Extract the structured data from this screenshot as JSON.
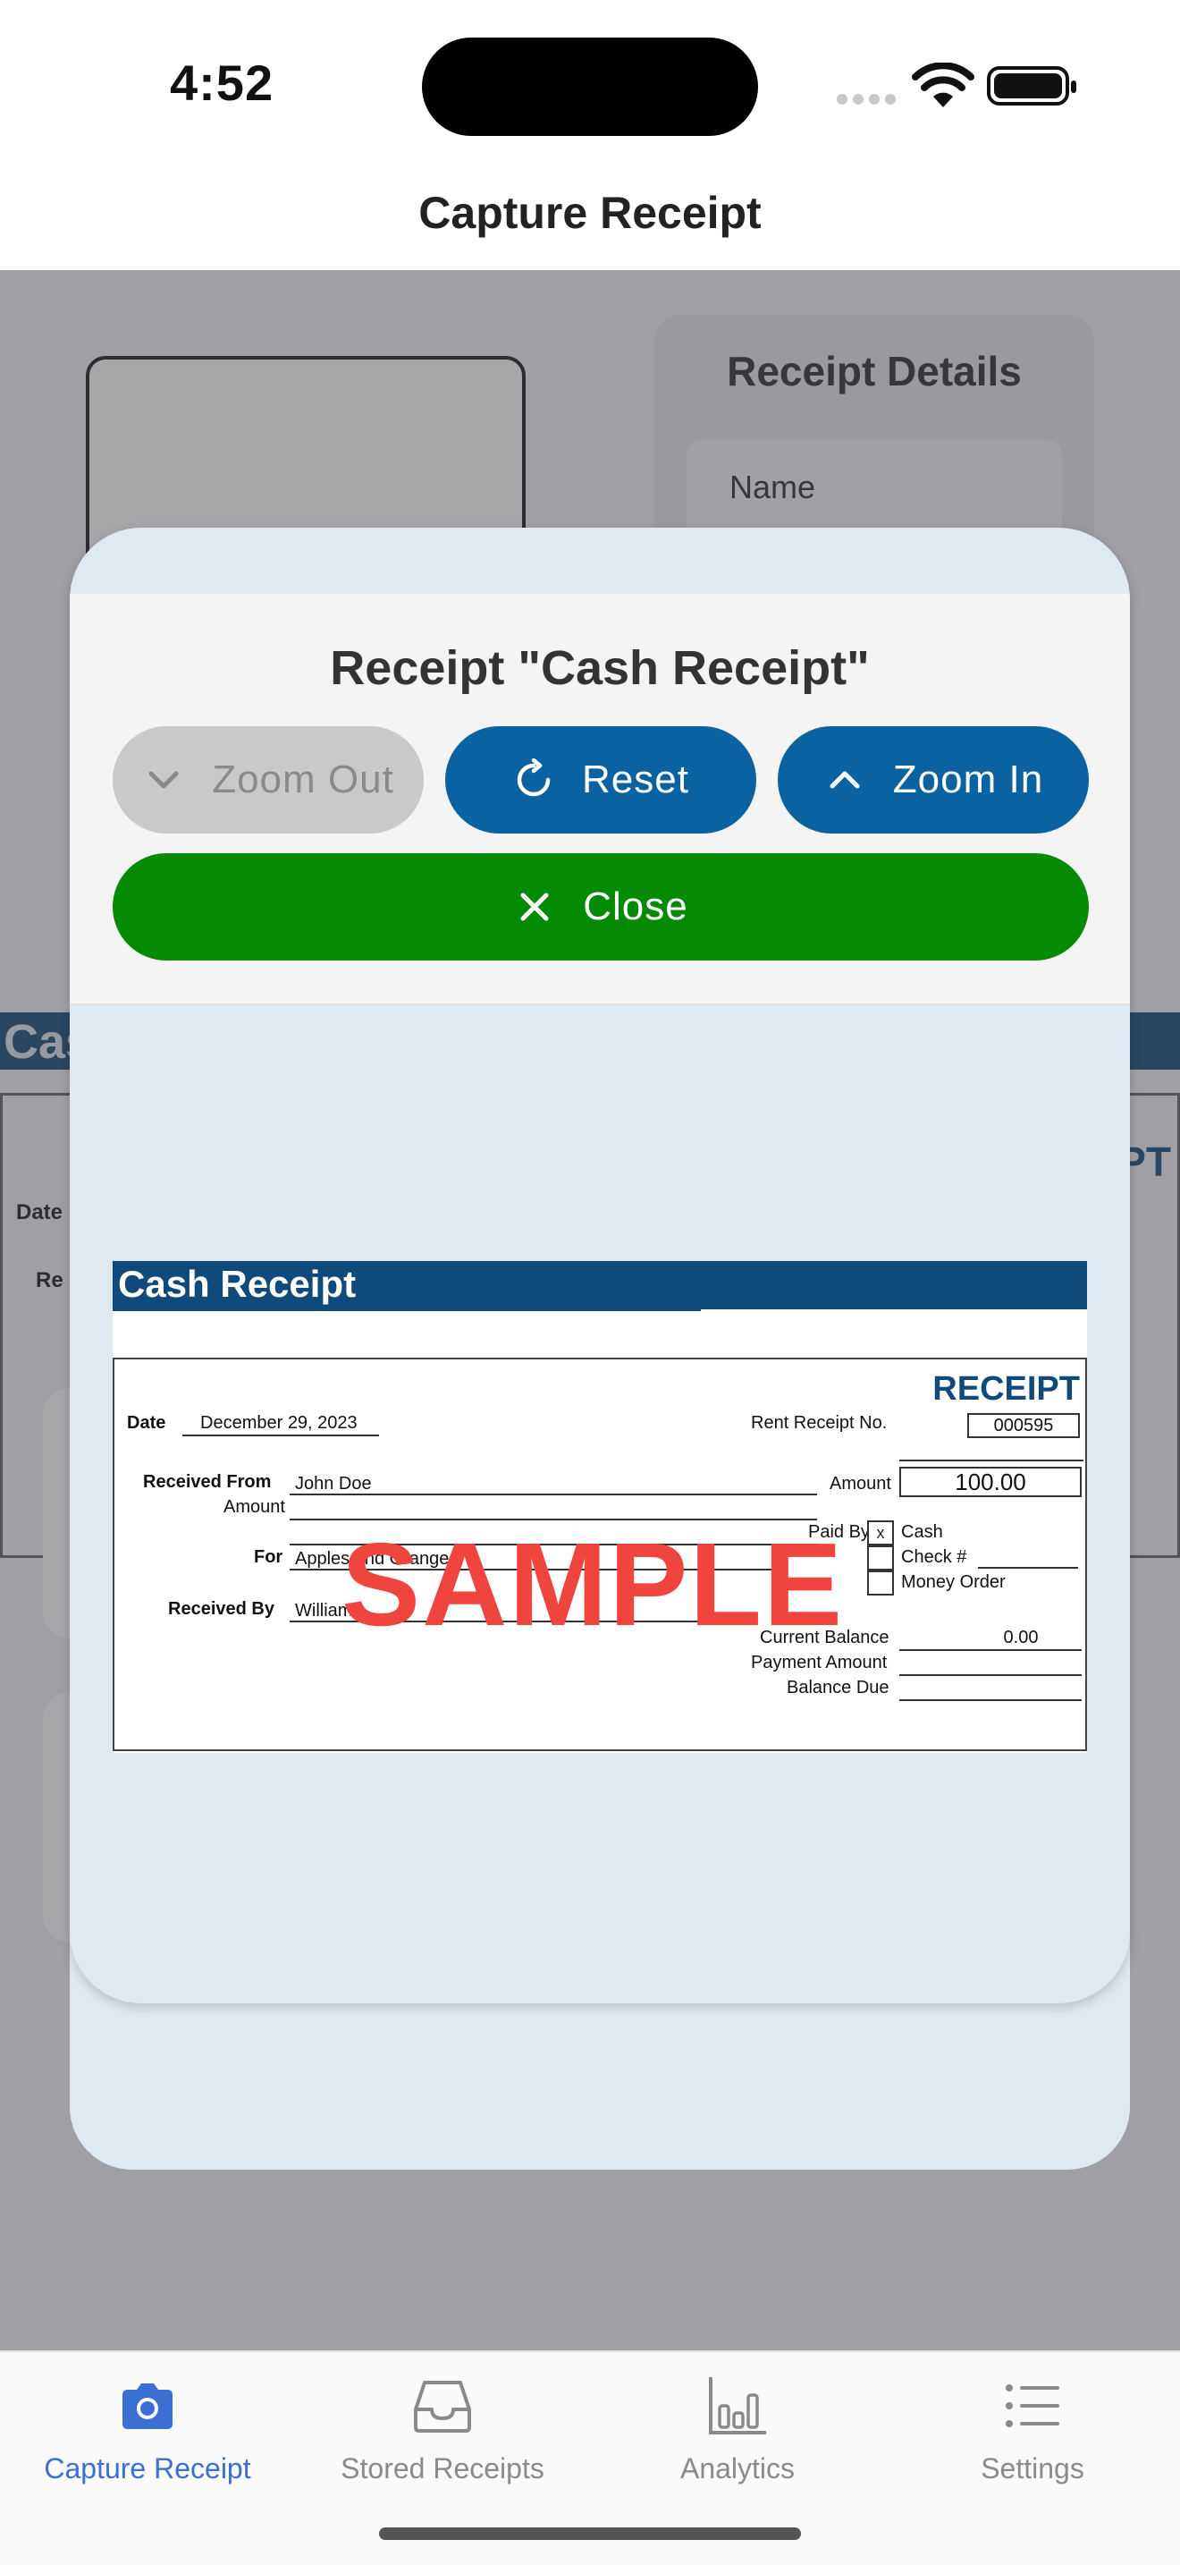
{
  "status_bar": {
    "time": "4:52"
  },
  "header": {
    "title": "Capture Receipt"
  },
  "background": {
    "details_title": "Receipt Details",
    "details_name_label": "Name",
    "receipt_band_text": "Cas",
    "receipt_word_fragment": "PT",
    "date_fragment": "Date",
    "received_fragment": "Re"
  },
  "modal": {
    "title": "Receipt \"Cash Receipt\"",
    "zoom_out_label": "Zoom Out",
    "reset_label": "Reset",
    "zoom_in_label": "Zoom In",
    "close_label": "Close",
    "zoom_out_enabled": false
  },
  "receipt": {
    "band_title": "Cash Receipt",
    "receipt_word": "RECEIPT",
    "date_label": "Date",
    "date_value": "December 29, 2023",
    "rent_receipt_no_label": "Rent Receipt No.",
    "rent_receipt_no_value": "000595",
    "received_from_label": "Received From",
    "received_from_value": "John Doe",
    "amount_label_left": "Amount",
    "amount_label_right": "Amount",
    "amount_value": "100.00",
    "paid_by_label": "Paid By",
    "paid_by_options": [
      {
        "label": "Cash",
        "mark": "x"
      },
      {
        "label": "Check #",
        "mark": ""
      },
      {
        "label": "Money Order",
        "mark": ""
      }
    ],
    "for_label": "For",
    "for_value": "Apples and Oranges",
    "received_by_label": "Received By",
    "received_by_value": "William",
    "current_balance_label": "Current Balance",
    "current_balance_value": "0.00",
    "payment_amount_label": "Payment Amount",
    "balance_due_label": "Balance Due",
    "watermark": "SAMPLE"
  },
  "tab_bar": {
    "tabs": [
      {
        "label": "Capture Receipt",
        "icon": "camera-icon",
        "active": true
      },
      {
        "label": "Stored Receipts",
        "icon": "inbox-tray-icon",
        "active": false
      },
      {
        "label": "Analytics",
        "icon": "bar-chart-icon",
        "active": false
      },
      {
        "label": "Settings",
        "icon": "list-icon",
        "active": false
      }
    ]
  },
  "colors": {
    "primary_button": "#0a62a0",
    "close_button": "#058a05",
    "disabled_button": "#c9c9c9",
    "active_tab": "#3b6fd4",
    "receipt_brand": "#0f4a7a",
    "watermark": "#f0453e"
  }
}
